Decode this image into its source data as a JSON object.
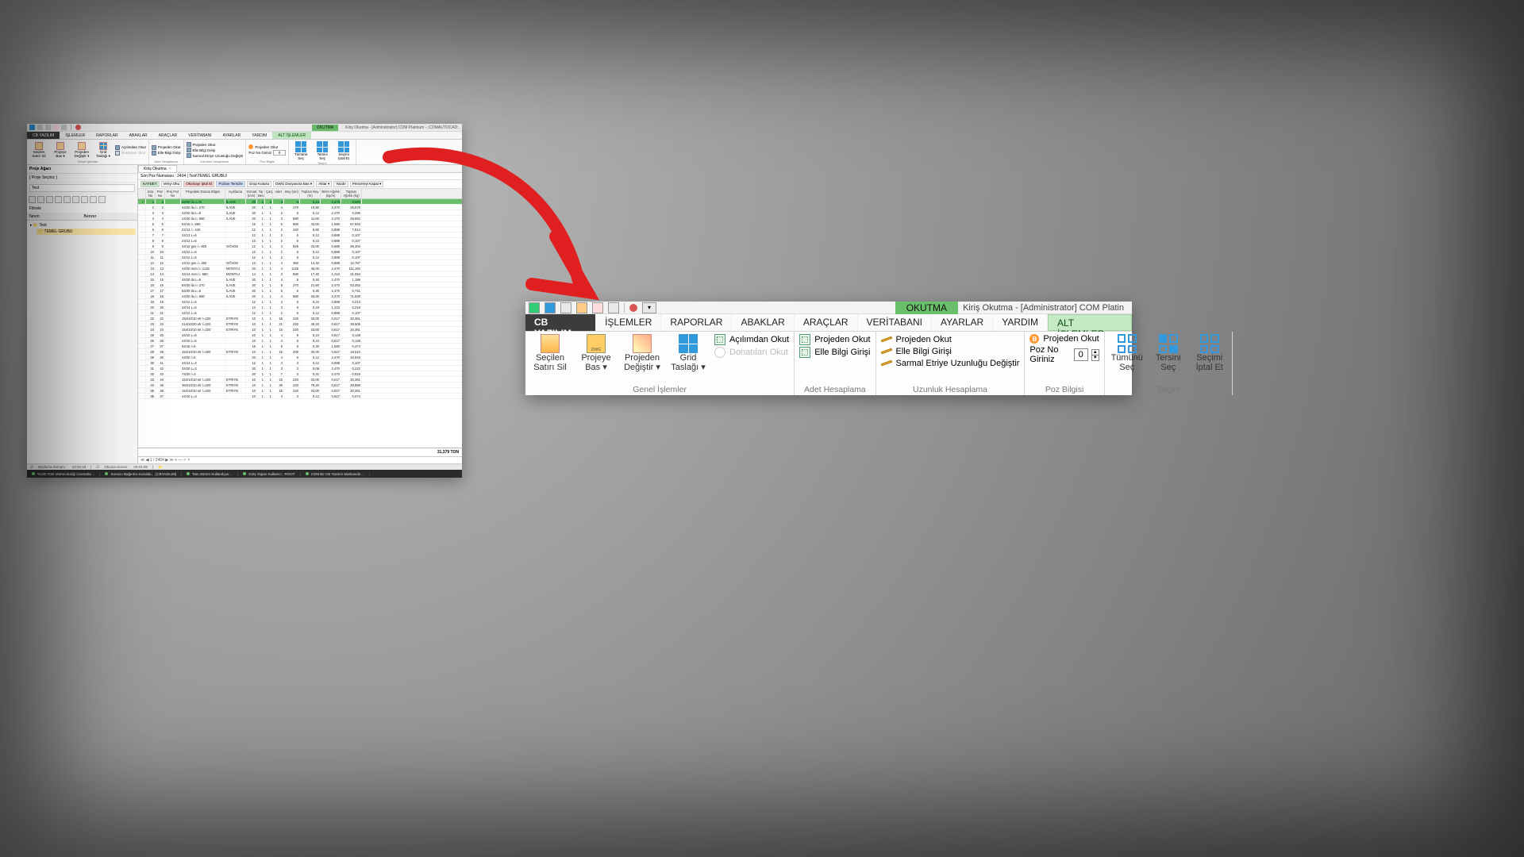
{
  "qat": {
    "active_title": "OKUTMA",
    "app_title": "Kiriş Okutma - [Administrator] COM Platinum -.:COMAUTOCAD:."
  },
  "menubar": [
    "CB YAZILIM",
    "İŞLEMLER",
    "RAPORLAR",
    "ABAKLAR",
    "ARAÇLAR",
    "VERİTABANI",
    "AYARLAR",
    "YARDIM",
    "ALT İŞLEMLER"
  ],
  "ribbon": {
    "groups": {
      "genel": {
        "label": "Genel İşlemler",
        "big": [
          {
            "key": "secilen",
            "ic": "open",
            "l1": "Seçilen",
            "l2": "Satırı Sil"
          },
          {
            "key": "projeye",
            "ic": "dwg",
            "l1": "Projeye",
            "l2": "Bas ▾"
          },
          {
            "key": "projeden",
            "ic": "pencil",
            "l1": "Projeden",
            "l2": "Değiştir ▾"
          },
          {
            "key": "grid",
            "ic": "grid",
            "l1": "Grid",
            "l2": "Taslağı ▾"
          }
        ],
        "cmds": [
          {
            "ic": "form",
            "t": "Açılımdan Okut"
          },
          {
            "ic": "ban",
            "t": "Donatıları Okut"
          }
        ]
      },
      "adet": {
        "label": "Adet Hesaplama",
        "cmds": [
          {
            "ic": "form",
            "t": "Projeden Okut"
          },
          {
            "ic": "form",
            "t": "Elle Bilgi Girişi"
          }
        ]
      },
      "uzunluk": {
        "label": "Uzunluk Hesaplama",
        "cmds": [
          {
            "ic": "ruler",
            "t": "Projeden Okut"
          },
          {
            "ic": "ruler",
            "t": "Elle Bilgi Girişi"
          },
          {
            "ic": "ruler",
            "t": "Sarmal Etriye Uzunluğu Değiştir"
          }
        ]
      },
      "poz": {
        "label": "Poz Bilgisi",
        "okut": "Projeden Okut",
        "nogir": "Poz No Giriniz",
        "nogir_val": "0"
      },
      "secim": {
        "label": "Seçim",
        "big": [
          {
            "key": "tumunu",
            "l1": "Tümünü",
            "l2": "Seç"
          },
          {
            "key": "tersini",
            "l1": "Tersini",
            "l2": "Seç"
          },
          {
            "key": "iptal",
            "l1": "Seçimi",
            "l2": "İptal Et"
          }
        ]
      }
    }
  },
  "left": {
    "panel_title": "Proje Ağacı",
    "proje_seciniz": "[ Proje Seçiniz ]",
    "search_val": "Test",
    "filtrele": "Filtrele",
    "col1": "Tanım",
    "col2": "Benzer",
    "tree_root": "Test",
    "tree_sel": "TEMEL GRUBU"
  },
  "doc": {
    "tab": "Kiriş Okutma",
    "poz_line": "Son Poz Numarası : 2404     |     Test\\TEMEL GRUBU\\",
    "actions": [
      "KAYDET",
      "Veriyi Oku",
      "Okumayı İptal Et",
      "Pozları Temizle",
      "Grup Kutusu",
      "DWG Dosyasına Bas ▾",
      "Aktar ▾",
      "Yazdır",
      "Pencereyi Kapat ▾"
    ],
    "columns": [
      "",
      "Sıra No",
      "Poz No",
      "Proj Poz No",
      "Projedeki Donatı Bilgisi",
      "Açıklama",
      "Donatı (mm)",
      "Tip Benzeri",
      "Çarpan",
      "Adet",
      "Boy (sm)",
      "Toplam Boy (m)",
      "Birim Ağırlık (kg/m)",
      "Toplam Ağırlık (kg)",
      ""
    ],
    "total": "31,379 TON",
    "pager": "1 / 2404"
  },
  "rows": [
    [
      "1",
      "1",
      "44/20 ila L=6",
      "İLAVE",
      "20",
      "1",
      "1",
      "4",
      "6",
      "0,24",
      "2,470",
      "0,593"
    ],
    [
      "2",
      "2",
      "44/20 ila /= 270",
      "İLAVE",
      "20",
      "1",
      "1",
      "4",
      "270",
      "10,80",
      "2,470",
      "26,676"
    ],
    [
      "3",
      "3",
      "24/20 ila L=6",
      "İLAVE",
      "20",
      "1",
      "1",
      "2",
      "6",
      "0,12",
      "2,470",
      "0,296"
    ],
    [
      "4",
      "4",
      "24/20 ila /= 580",
      "İLAVE",
      "20",
      "1",
      "1",
      "3",
      "580",
      "11,60",
      "2,470",
      "28,652"
    ],
    [
      "5",
      "5",
      "54/16 /= 860",
      "",
      "16",
      "1",
      "1",
      "5",
      "860",
      "43,00",
      "1,580",
      "67,940"
    ],
    [
      "6",
      "6",
      "24/12 /= 440",
      "",
      "12",
      "1",
      "1",
      "2",
      "440",
      "8,80",
      "0,888",
      "7,814"
    ],
    [
      "7",
      "7",
      "24/12 L=6",
      "",
      "12",
      "1",
      "1",
      "2",
      "6",
      "0,12",
      "0,888",
      "0,107"
    ],
    [
      "8",
      "8",
      "24/12 L=6",
      "",
      "12",
      "1",
      "1",
      "2",
      "6",
      "0,12",
      "0,888",
      "0,107"
    ],
    [
      "9",
      "9",
      "44/12  gov  /= 825",
      "GÖVDE",
      "12",
      "1",
      "1",
      "4",
      "825",
      "33,00",
      "0,888",
      "29,304"
    ],
    [
      "10",
      "10",
      "24/12 L=6",
      "",
      "12",
      "1",
      "1",
      "2",
      "6",
      "0,12",
      "0,888",
      "0,107"
    ],
    [
      "11",
      "11",
      "24/12 L=6",
      "",
      "12",
      "1",
      "1",
      "2",
      "6",
      "0,12",
      "0,888",
      "0,107"
    ],
    [
      "12",
      "12",
      "44/12  gov  /= 360",
      "GÖVDE",
      "12",
      "1",
      "1",
      "4",
      "360",
      "14,40",
      "0,888",
      "12,787"
    ],
    [
      "13",
      "13",
      "44/20 mon  /= 1125",
      "MONTAJ",
      "20",
      "1",
      "1",
      "4",
      "1125",
      "45,00",
      "2,470",
      "111,150"
    ],
    [
      "14",
      "14",
      "34/14 mon  /= 580",
      "MONTAJ",
      "14",
      "1",
      "1",
      "3",
      "580",
      "17,40",
      "1,210",
      "21,054"
    ],
    [
      "15",
      "15",
      "44/20 ila L=6",
      "İLAVE",
      "20",
      "1",
      "1",
      "4",
      "6",
      "0,40",
      "2,470",
      "1,186"
    ],
    [
      "16",
      "16",
      "84/20 ila /= 270",
      "İLAVE",
      "20",
      "1",
      "1",
      "8",
      "270",
      "21,60",
      "2,470",
      "53,352"
    ],
    [
      "17",
      "17",
      "54/20 ila L=6",
      "İLAVE",
      "20",
      "1",
      "1",
      "5",
      "6",
      "0,30",
      "2,470",
      "0,741"
    ],
    [
      "18",
      "18",
      "44/20 ila /= 580",
      "İLAVE",
      "20",
      "1",
      "1",
      "4",
      "580",
      "26,00",
      "2,470",
      "71,630"
    ],
    [
      "19",
      "19",
      "44/12 L=6",
      "",
      "12",
      "1",
      "1",
      "4",
      "6",
      "0,24",
      "0,888",
      "0,213"
    ],
    [
      "20",
      "20",
      "34/14 L=6",
      "",
      "14",
      "1",
      "1",
      "3",
      "6",
      "0,18",
      "1,210",
      "0,218"
    ],
    [
      "21",
      "21",
      "24/12 L=6",
      "",
      "12",
      "1",
      "1",
      "2",
      "6",
      "0,12",
      "0,888",
      "0,107"
    ],
    [
      "22",
      "22",
      "154/10/10 etr /=220",
      "ETRİYE",
      "10",
      "1",
      "1",
      "15",
      "220",
      "33,00",
      "0,617",
      "20,361"
    ],
    [
      "23",
      "23",
      "214/10/20 etr /=220",
      "ETRİYE",
      "10",
      "1",
      "1",
      "21",
      "220",
      "46,20",
      "0,617",
      "28,505"
    ],
    [
      "24",
      "24",
      "154/10/10 etr /=220",
      "ETRİYE",
      "10",
      "1",
      "1",
      "15",
      "220",
      "33,00",
      "0,617",
      "20,361"
    ],
    [
      "25",
      "25",
      "44/10 L=6",
      "",
      "10",
      "1",
      "1",
      "4",
      "6",
      "0,24",
      "0,617",
      "0,148"
    ],
    [
      "26",
      "26",
      "44/10 L=6",
      "",
      "10",
      "1",
      "1",
      "4",
      "6",
      "0,24",
      "0,617",
      "0,148"
    ],
    [
      "27",
      "27",
      "54/16 /=6",
      "",
      "16",
      "1",
      "1",
      "5",
      "6",
      "0,30",
      "1,580",
      "0,474"
    ],
    [
      "28",
      "28",
      "154/10/10 etr /=200",
      "ETRİYE",
      "10",
      "1",
      "1",
      "15",
      "200",
      "30,00",
      "0,617",
      "18,510"
    ],
    [
      "29",
      "40",
      "44/20 /=6",
      "",
      "20",
      "1",
      "1",
      "4",
      "6",
      "0,12",
      "2,470",
      "34,943"
    ],
    [
      "30",
      "41",
      "44/12 L=3",
      "",
      "12",
      "1",
      "1",
      "4",
      "3",
      "0,12",
      "0,888",
      "0,107"
    ],
    [
      "31",
      "42",
      "34/20 L=3",
      "",
      "20",
      "1",
      "1",
      "3",
      "3",
      "0,09",
      "2,470",
      "0,222"
    ],
    [
      "32",
      "43",
      "74/20 /=3",
      "",
      "20",
      "1",
      "1",
      "7",
      "3",
      "0,21",
      "2,470",
      "0,519"
    ],
    [
      "33",
      "44",
      "154/10/10 etr /=220",
      "ETRİYE",
      "10",
      "1",
      "1",
      "15",
      "220",
      "33,00",
      "0,617",
      "20,361"
    ],
    [
      "34",
      "45",
      "364/10/10 etr /=220",
      "ETRİYE",
      "10",
      "1",
      "1",
      "36",
      "220",
      "79,20",
      "0,617",
      "48,866"
    ],
    [
      "35",
      "46",
      "154/10/10 etr /=220",
      "ETRİYE",
      "10",
      "1",
      "1",
      "15",
      "220",
      "33,00",
      "0,617",
      "20,361"
    ],
    [
      "36",
      "47",
      "44/10 L=3",
      "",
      "10",
      "1",
      "1",
      "4",
      "3",
      "0,12",
      "0,617",
      "0,074"
    ]
  ],
  "status": {
    "seg1": "%100 Türk Mühendisliği Ürünüdür…",
    "seg2": "Sunucu Bağıntısı Kuruldu… [CBYAZILIM]",
    "seg3": "Tam Sürüm Kullanılıyor…",
    "seg4": "Giriş Yapan Kullanıcı : ROOT",
    "seg5": "COM Bir CB Yazılım Markasıdır…"
  },
  "status_times": {
    "bas_l": "Başlama Zamanı :",
    "bas_v": "10:49:18",
    "oku_l": "Okuma Süresi :",
    "oku_v": "00:01:09"
  },
  "callout": {
    "qat_active": "OKUTMA",
    "title": "Kiriş Okutma - [Administrator] COM Platin",
    "spin_val": "0",
    "spin_label": "Poz No Giriniz",
    "okut": "Projeden Okut"
  }
}
